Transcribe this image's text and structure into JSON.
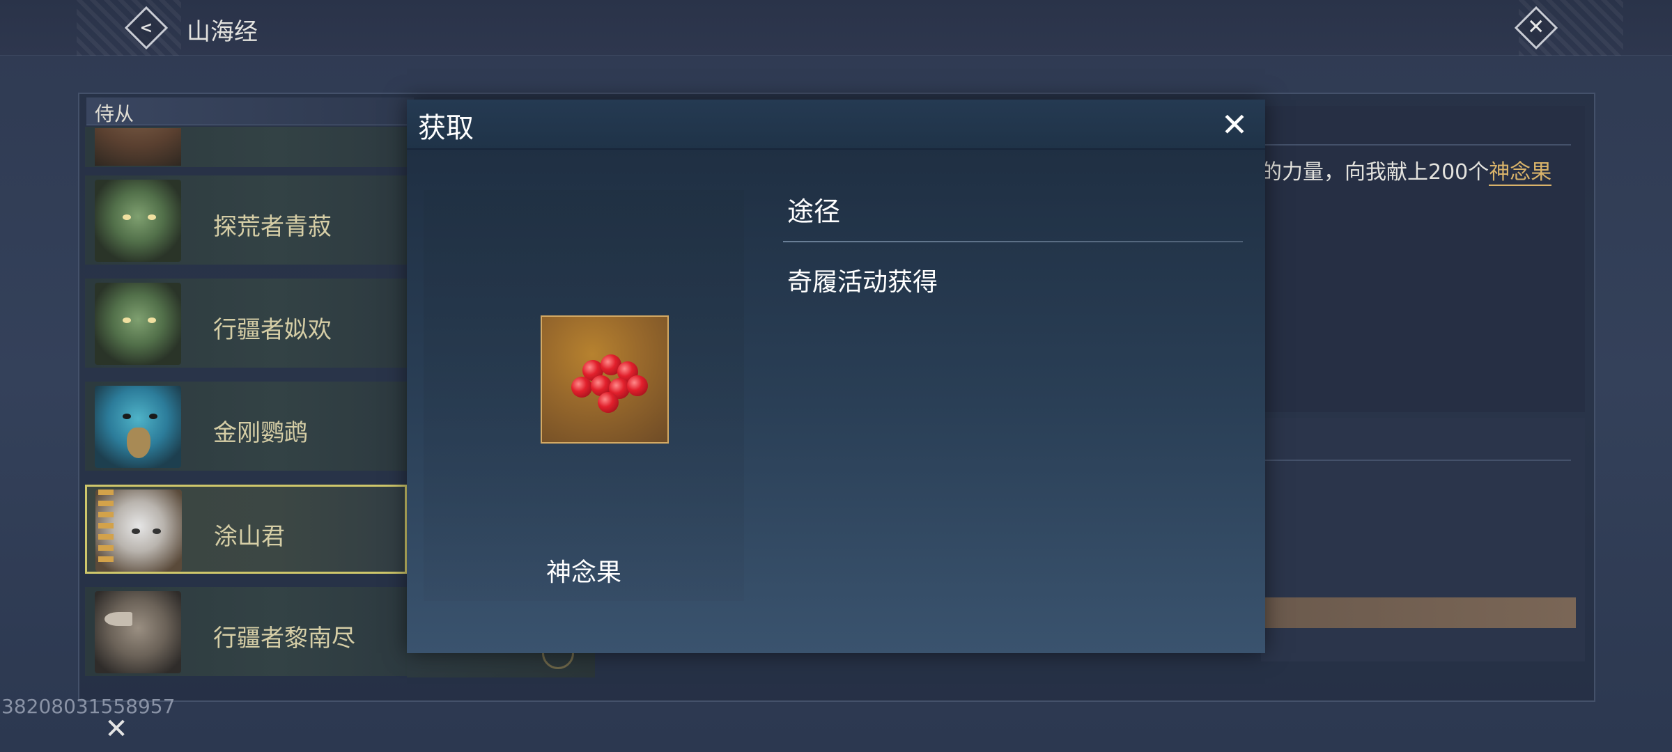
{
  "header": {
    "back_icon": "chevron-left-icon",
    "title": "山海经",
    "close_icon": "close-x-icon"
  },
  "companions": {
    "section_label": "侍从",
    "items": [
      {
        "name": "",
        "portrait": "partial-portrait"
      },
      {
        "name": "探荒者青菽",
        "portrait": "goblin-portrait"
      },
      {
        "name": "行疆者姒欢",
        "portrait": "goblin-portrait"
      },
      {
        "name": "金刚鹦鹉",
        "portrait": "parrot-portrait"
      },
      {
        "name": "涂山君",
        "portrait": "lady-portrait",
        "selected": true
      },
      {
        "name": "行疆者黎南尽",
        "portrait": "rhino-portrait"
      }
    ]
  },
  "quest": {
    "text_prefix": "的力量，向我献上200个",
    "highlight": "神念果",
    "highlight_color": "#d9b36a"
  },
  "footer": {
    "uid": "38208031558957"
  },
  "modal": {
    "title": "获取",
    "close_icon": "close-x-icon",
    "item": {
      "name": "神念果",
      "icon": "red-berries-icon"
    },
    "sources_label": "途径",
    "sources": [
      "奇履活动获得"
    ]
  }
}
